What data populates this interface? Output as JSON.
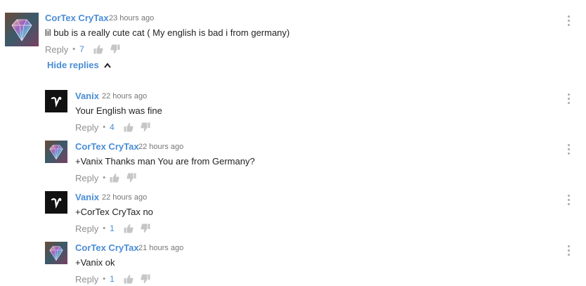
{
  "colors": {
    "author": "#4a8dd6",
    "text": "#222222",
    "muted": "#909090",
    "avatar_dark": "#111111"
  },
  "top_comment": {
    "author": "CorTex CryTax",
    "time": "23 hours ago",
    "text": "lil bub is a really cute cat ( My english is bad i from germany)",
    "reply_label": "Reply",
    "likes": "7",
    "avatar_icon": "diamond-avatar-icon"
  },
  "hide_replies_label": "Hide replies",
  "replies": [
    {
      "author": "Vanix",
      "time": "22 hours ago",
      "text": "Your English was fine",
      "reply_label": "Reply",
      "likes": "4",
      "avatar_icon": "vanix-logo-icon"
    },
    {
      "author": "CorTex CryTax",
      "time": "22 hours ago",
      "text": "+Vanix Thanks man You are from Germany?",
      "reply_label": "Reply",
      "likes": "",
      "avatar_icon": "diamond-avatar-icon"
    },
    {
      "author": "Vanix",
      "time": "22 hours ago",
      "text": "+CorTex CryTax no",
      "reply_label": "Reply",
      "likes": "1",
      "avatar_icon": "vanix-logo-icon"
    },
    {
      "author": "CorTex CryTax",
      "time": "21 hours ago",
      "text": "+Vanix ok",
      "reply_label": "Reply",
      "likes": "1",
      "avatar_icon": "diamond-avatar-icon"
    }
  ]
}
